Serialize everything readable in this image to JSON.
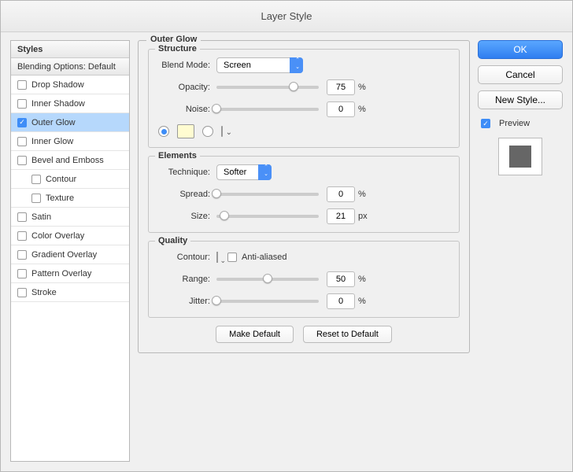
{
  "title": "Layer Style",
  "sidebar": {
    "header": "Styles",
    "blending": "Blending Options: Default",
    "items": [
      {
        "label": "Drop Shadow",
        "checked": false,
        "indent": false,
        "selected": false
      },
      {
        "label": "Inner Shadow",
        "checked": false,
        "indent": false,
        "selected": false
      },
      {
        "label": "Outer Glow",
        "checked": true,
        "indent": false,
        "selected": true
      },
      {
        "label": "Inner Glow",
        "checked": false,
        "indent": false,
        "selected": false
      },
      {
        "label": "Bevel and Emboss",
        "checked": false,
        "indent": false,
        "selected": false
      },
      {
        "label": "Contour",
        "checked": false,
        "indent": true,
        "selected": false
      },
      {
        "label": "Texture",
        "checked": false,
        "indent": true,
        "selected": false
      },
      {
        "label": "Satin",
        "checked": false,
        "indent": false,
        "selected": false
      },
      {
        "label": "Color Overlay",
        "checked": false,
        "indent": false,
        "selected": false
      },
      {
        "label": "Gradient Overlay",
        "checked": false,
        "indent": false,
        "selected": false
      },
      {
        "label": "Pattern Overlay",
        "checked": false,
        "indent": false,
        "selected": false
      },
      {
        "label": "Stroke",
        "checked": false,
        "indent": false,
        "selected": false
      }
    ]
  },
  "panel": {
    "title": "Outer Glow",
    "structure": {
      "legend": "Structure",
      "blend_mode_label": "Blend Mode:",
      "blend_mode_value": "Screen",
      "opacity_label": "Opacity:",
      "opacity_value": "75",
      "opacity_unit": "%",
      "noise_label": "Noise:",
      "noise_value": "0",
      "noise_unit": "%",
      "color_swatch": "#fffcd1"
    },
    "elements": {
      "legend": "Elements",
      "technique_label": "Technique:",
      "technique_value": "Softer",
      "spread_label": "Spread:",
      "spread_value": "0",
      "spread_unit": "%",
      "size_label": "Size:",
      "size_value": "21",
      "size_unit": "px"
    },
    "quality": {
      "legend": "Quality",
      "contour_label": "Contour:",
      "anti_aliased_label": "Anti-aliased",
      "range_label": "Range:",
      "range_value": "50",
      "range_unit": "%",
      "jitter_label": "Jitter:",
      "jitter_value": "0",
      "jitter_unit": "%"
    },
    "buttons": {
      "make_default": "Make Default",
      "reset_default": "Reset to Default"
    }
  },
  "right": {
    "ok": "OK",
    "cancel": "Cancel",
    "new_style": "New Style...",
    "preview_label": "Preview",
    "preview_checked": true
  }
}
